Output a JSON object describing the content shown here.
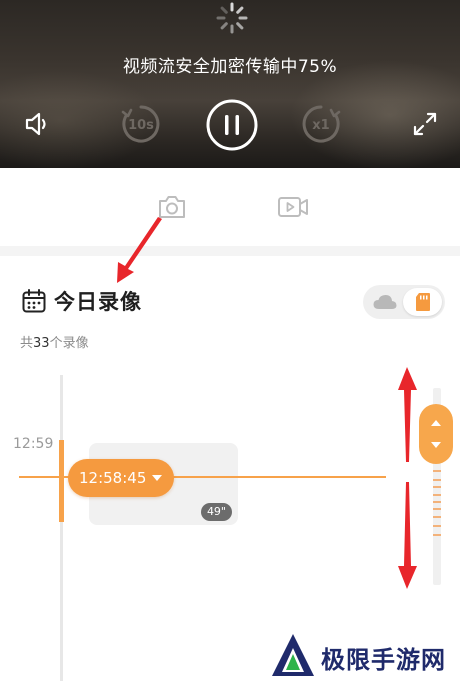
{
  "player": {
    "status_text": "视频流安全加密传输中75%",
    "progress_percent": 75,
    "rewind_label": "10s",
    "speed_label": "x1"
  },
  "recordings": {
    "title": "今日录像",
    "count_prefix": "共",
    "count": "33",
    "count_suffix": "个录像"
  },
  "timeline": {
    "tick_label": "12:59",
    "current_time": "12:58:45",
    "clip_duration": "49\""
  },
  "watermark": {
    "text": "极限手游网"
  },
  "colors": {
    "accent": "#f59a3f",
    "annotation": "#e8262b",
    "icon_gray": "#bdbdbd"
  },
  "icons": {
    "volume": "speaker-icon",
    "rewind": "rewind-10s-icon",
    "pause": "pause-icon",
    "speed": "playback-speed-icon",
    "fullscreen": "fullscreen-icon",
    "snapshot": "camera-icon",
    "record": "video-camera-icon",
    "calendar": "calendar-icon",
    "cloud": "cloud-icon",
    "sd_card": "sd-card-icon"
  }
}
